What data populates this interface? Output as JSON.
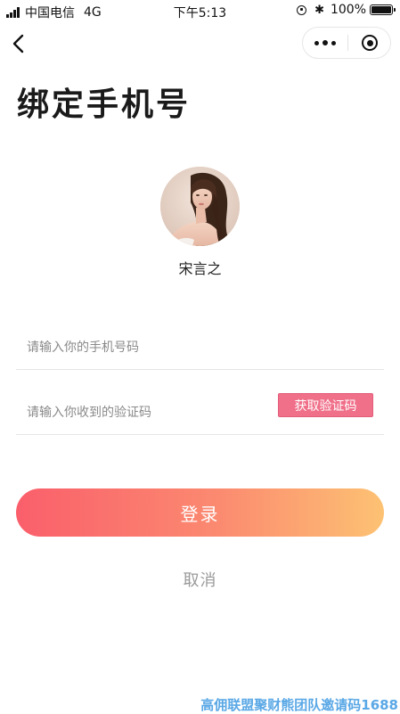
{
  "status_bar": {
    "carrier": "中国电信",
    "network": "4G",
    "time": "下午5:13",
    "battery_pct": "100%",
    "bluetooth_glyph": "✱",
    "icons": [
      "signal-icon",
      "rotation-lock-icon",
      "bluetooth-icon",
      "battery-icon"
    ]
  },
  "nav": {
    "back_icon": "chevron-left-icon",
    "capsule_icons": [
      "more-dots-icon",
      "close-target-icon"
    ]
  },
  "page": {
    "title": "绑定手机号"
  },
  "profile": {
    "username": "宋言之"
  },
  "form": {
    "phone_placeholder": "请输入你的手机号码",
    "phone_value": "",
    "code_placeholder": "请输入你收到的验证码",
    "code_value": "",
    "get_code_label": "获取验证码"
  },
  "actions": {
    "login_label": "登录",
    "cancel_label": "取消"
  },
  "watermark": "高佣联盟聚财熊团队邀请码1688",
  "colors": {
    "accent_start": "#fa5f6b",
    "accent_end": "#fdc273",
    "get_code_bg": "#f0708a",
    "watermark": "#5aa8e6"
  }
}
